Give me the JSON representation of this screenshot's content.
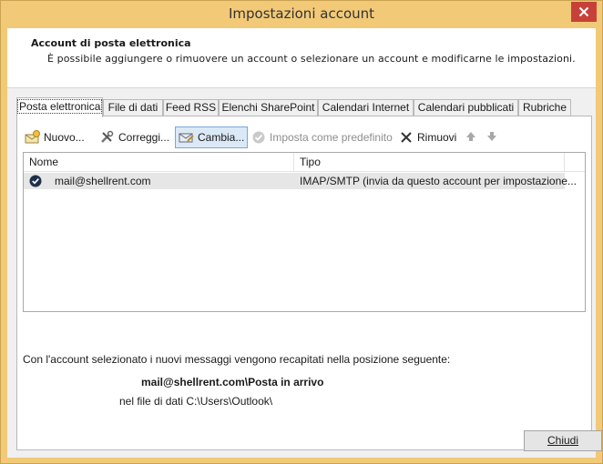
{
  "window": {
    "title": "Impostazioni account",
    "close_icon": "close-icon",
    "accent_color": "#f2c977"
  },
  "header": {
    "title": "Account di posta elettronica",
    "description": "È possibile aggiungere o rimuovere un account o selezionare un account e modificarne le impostazioni."
  },
  "tabs": [
    {
      "label": "Posta elettronica",
      "active": true
    },
    {
      "label": "File di dati"
    },
    {
      "label": "Feed RSS"
    },
    {
      "label": "Elenchi SharePoint"
    },
    {
      "label": "Calendari Internet"
    },
    {
      "label": "Calendari pubblicati"
    },
    {
      "label": "Rubriche"
    }
  ],
  "toolbar": {
    "new_label": "Nuovo...",
    "repair_label": "Correggi...",
    "change_label": "Cambia...",
    "set_default_label": "Imposta come predefinito",
    "remove_label": "Rimuovi"
  },
  "accounts_table": {
    "columns": [
      "Nome",
      "Tipo"
    ],
    "rows": [
      {
        "name": "mail@shellrent.com",
        "type": "IMAP/SMTP (invia da questo account per impostazione..."
      }
    ]
  },
  "delivery": {
    "info": "Con l'account selezionato i nuovi messaggi vengono recapitati nella posizione seguente:",
    "location": "mail@shellrent.com\\Posta in arrivo",
    "datafile": "nel file di dati C:\\Users\\Outlook\\"
  },
  "footer": {
    "close_label": "Chiudi"
  }
}
